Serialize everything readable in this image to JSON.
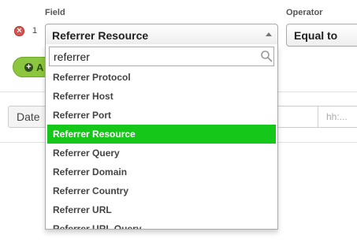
{
  "headers": {
    "field": "Field",
    "operator": "Operator"
  },
  "filter_row": {
    "number": "1",
    "field_value": "Referrer Resource",
    "operator_value": "Equal to"
  },
  "add_button": {
    "label": "A"
  },
  "date_filter": {
    "label": "Date",
    "time_placeholder": "hh:..."
  },
  "dropdown": {
    "search_value": "referrer",
    "options": [
      "Referrer Protocol",
      "Referrer Host",
      "Referrer Port",
      "Referrer Resource",
      "Referrer Query",
      "Referrer Domain",
      "Referrer Country",
      "Referrer URL",
      "Referrer URL Query"
    ],
    "selected": "Referrer Resource"
  },
  "colors": {
    "highlight": "#15c718",
    "add_green": "#8cc63f",
    "remove_red": "#d9534f"
  },
  "icons": {
    "remove": "remove-circle-icon",
    "search": "search-icon",
    "add": "plus-circle-icon",
    "select_arrow": "caret-up-icon"
  }
}
